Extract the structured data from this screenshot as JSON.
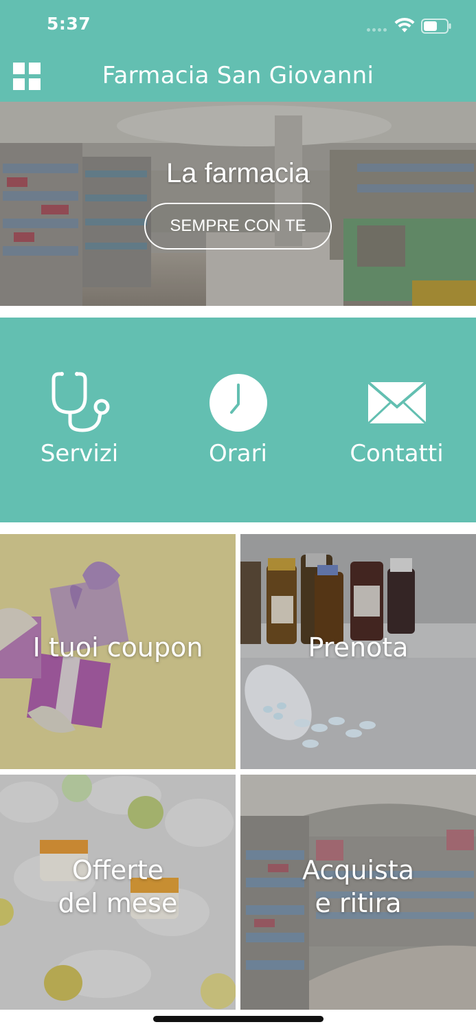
{
  "status_bar": {
    "time": "5:37"
  },
  "header": {
    "title": "Farmacia San Giovanni",
    "menu_icon": "grid-icon"
  },
  "hero": {
    "title": "La farmacia",
    "button_label": "SEMPRE CON TE"
  },
  "quick_actions": [
    {
      "label": "Servizi",
      "icon": "stethoscope-icon"
    },
    {
      "label": "Orari",
      "icon": "clock-icon"
    },
    {
      "label": "Contatti",
      "icon": "envelope-icon"
    }
  ],
  "tiles": [
    {
      "label_line1": "I tuoi coupon",
      "label_line2": ""
    },
    {
      "label_line1": "Prenota",
      "label_line2": ""
    },
    {
      "label_line1": "Offerte",
      "label_line2": "del mese"
    },
    {
      "label_line1": "Acquista",
      "label_line2": "e ritira"
    }
  ],
  "colors": {
    "brand": "#63bfb1",
    "background": "#ffffff"
  }
}
